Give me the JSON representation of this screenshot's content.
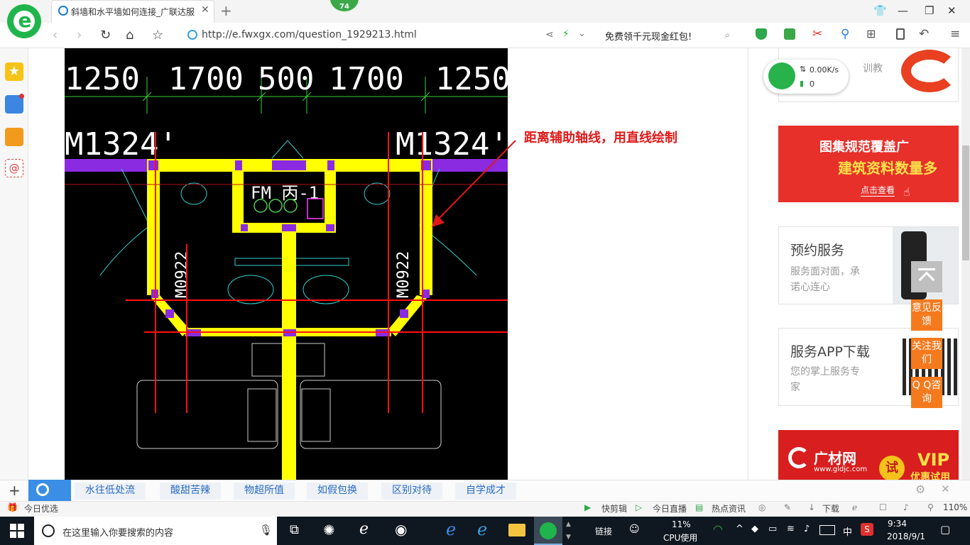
{
  "browser": {
    "tab_title": "斜墙和水平墙如何连接_广联达服",
    "score_badge": "74",
    "url": "http://e.fwxgx.com/question_1929213.html",
    "promo": "免费领千元现金红包!",
    "net_speed": "0.00K/s",
    "net_count": "0"
  },
  "drawing": {
    "dims": [
      "1250",
      "1700",
      "500",
      "1700",
      "1250"
    ],
    "door_top_left": "M1324'",
    "door_top_right": "M1324'",
    "door_side_left": "M0922",
    "door_side_right": "M0922",
    "room_label": "FM 丙-1",
    "annotation": "距离辅助轴线，用直线绘制"
  },
  "sidebar_right": {
    "top_card_sub": "训教",
    "ad1_line1": "图集规范覆盖广",
    "ad1_line2": "建筑资料数量多",
    "ad1_cta": "点击查看",
    "card_booking": {
      "title": "预约服务",
      "sub1": "服务面对面，承",
      "sub2": "诺心连心"
    },
    "card_app": {
      "title": "服务APP下载",
      "sub1": "您的掌上服务专",
      "sub2": "家"
    },
    "ad2_brand": "广材网",
    "ad2_domain": "www.gldjc.com",
    "ad2_try": "试",
    "ad2_vip": "VIP",
    "ad2_sub": "优惠试用",
    "float_feedback": "意见反馈",
    "float_follow": "关注我们",
    "float_qq": "Q Q咨询"
  },
  "tag_bar": {
    "tags": [
      "水往低处流",
      "酸甜苦辣",
      "物超所值",
      "如假包换",
      "区别对待",
      "自学成才"
    ]
  },
  "status_bar": {
    "left": "今日优选",
    "items": [
      "快剪辑",
      "今日直播",
      "热点资讯",
      "下载"
    ],
    "zoom": "110%"
  },
  "taskbar": {
    "search_placeholder": "在这里输入你要搜索的内容",
    "link_label": "链接",
    "cpu_percent": "11%",
    "cpu_label": "CPU使用",
    "ime": "中",
    "time": "9:34",
    "date": "2018/9/1"
  },
  "colors": {
    "accent": "#1fb54c",
    "annotation": "#e01818",
    "float_orange": "#f57a1e",
    "wall_yellow": "#ffff00"
  }
}
